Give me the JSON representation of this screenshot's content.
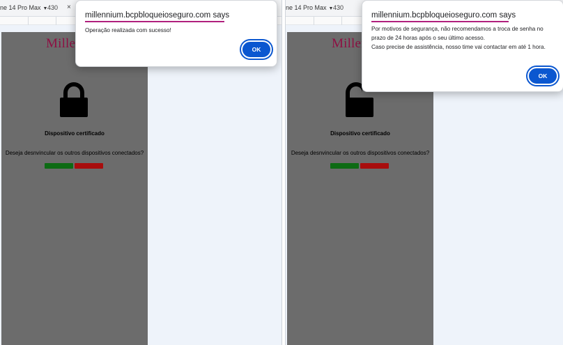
{
  "left": {
    "devbar": {
      "device": "ne 14 Pro Max",
      "width": "430",
      "close": "×"
    },
    "app": {
      "brand": "Millennium",
      "certified_label": "Dispositivo certificado",
      "question": "Deseja desnvincular os outros dispositivos conectados?",
      "lock_icon": "locked-padlock-icon"
    },
    "dialog": {
      "origin": "millennium.bcpbloqueioseguro.com says",
      "message": "Operação realizada com sucesso!",
      "ok_label": "OK"
    }
  },
  "right": {
    "devbar": {
      "device": "ne 14 Pro Max",
      "width": "430"
    },
    "app": {
      "brand": "Millen",
      "certified_label": "Dispositivo certificado",
      "question": "Deseja desnvincular os outros dispositivos conectados?",
      "lock_icon": "unlocked-padlock-icon"
    },
    "dialog": {
      "origin": "millennium.bcpbloqueioseguro.com says",
      "message_lines": [
        "Por motivos de segurança, não recomendamos a troca de senha no",
        "prazo de 24 horas após o seu último acesso.",
        "Caso precise de assistência, nosso time vai contactar em até 1 hora."
      ],
      "ok_label": "OK"
    }
  },
  "colors": {
    "brand": "#8e1043",
    "underline": "#b0207d",
    "ok_button": "#0b57d0",
    "confirm_button": "#0d6b14",
    "deny_button": "#a80d0d",
    "mobile_bg": "#6c6c6c"
  }
}
